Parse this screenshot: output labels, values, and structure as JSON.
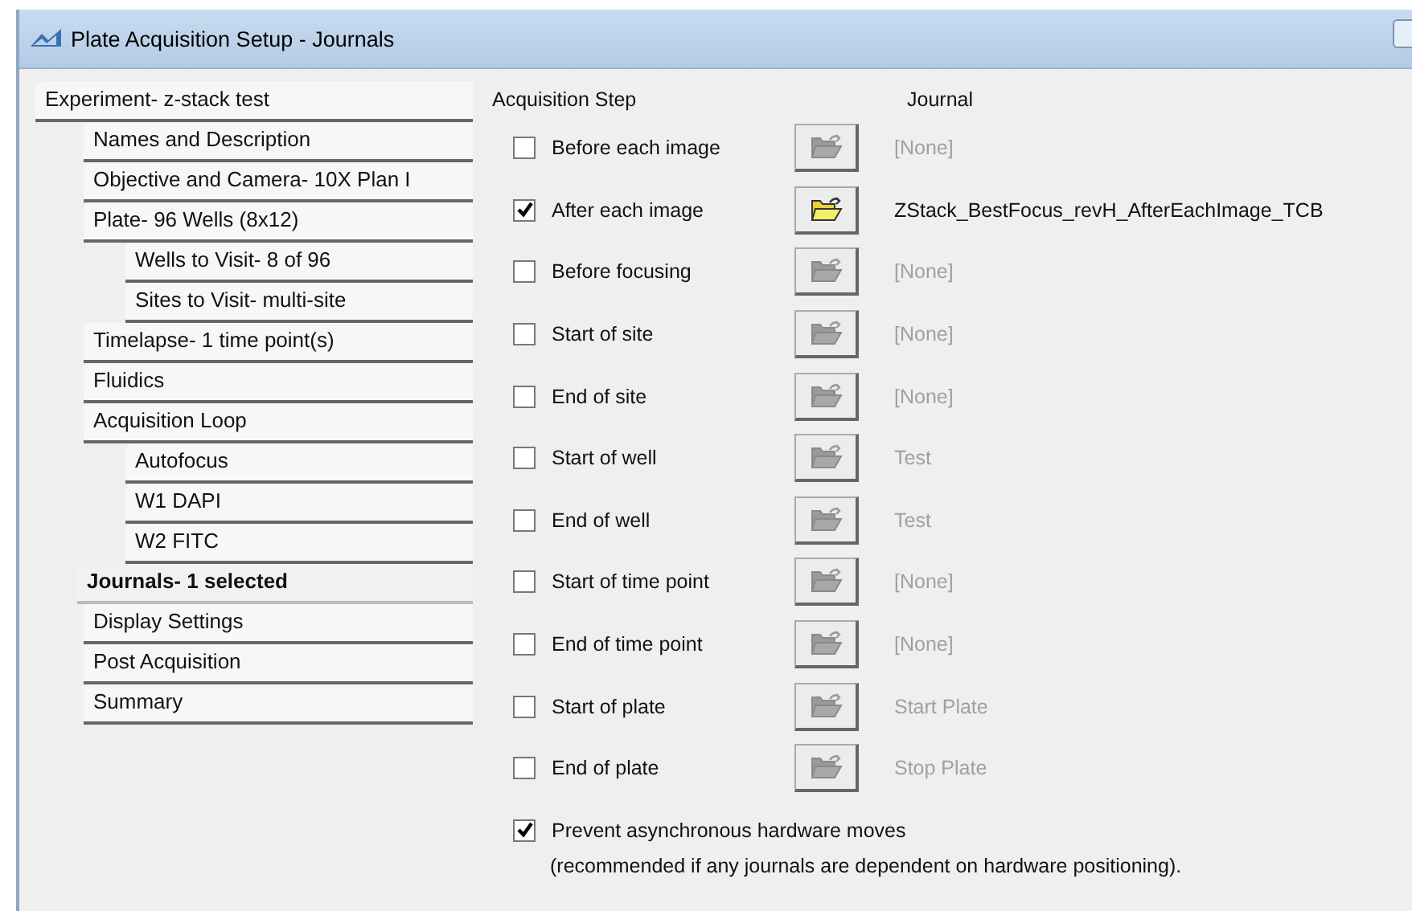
{
  "window": {
    "title": "Plate Acquisition Setup - Journals"
  },
  "tree": [
    {
      "label": "Experiment- z-stack test",
      "selected": false,
      "children": [
        {
          "label": "Names and Description",
          "selected": false
        },
        {
          "label": "Objective and Camera- 10X Plan I",
          "selected": false
        },
        {
          "label": "Plate- 96 Wells (8x12)",
          "selected": false,
          "children": [
            {
              "label": "Wells to Visit- 8 of 96",
              "selected": false
            },
            {
              "label": "Sites to Visit- multi-site",
              "selected": false
            }
          ]
        },
        {
          "label": "Timelapse- 1 time point(s)",
          "selected": false
        },
        {
          "label": "Fluidics",
          "selected": false
        },
        {
          "label": "Acquisition Loop",
          "selected": false,
          "children": [
            {
              "label": "Autofocus",
              "selected": false
            },
            {
              "label": "W1 DAPI",
              "selected": false
            },
            {
              "label": "W2 FITC",
              "selected": false
            }
          ]
        },
        {
          "label": "Journals- 1 selected",
          "selected": true
        },
        {
          "label": "Display Settings",
          "selected": false
        },
        {
          "label": "Post Acquisition",
          "selected": false
        },
        {
          "label": "Summary",
          "selected": false
        }
      ]
    }
  ],
  "headers": {
    "step": "Acquisition Step",
    "journal": "Journal"
  },
  "steps": [
    {
      "label": "Before each image",
      "checked": false,
      "journal": "[None]"
    },
    {
      "label": "After each image",
      "checked": true,
      "journal": "ZStack_BestFocus_revH_AfterEachImage_TCB"
    },
    {
      "label": "Before focusing",
      "checked": false,
      "journal": "[None]"
    },
    {
      "label": "Start of site",
      "checked": false,
      "journal": "[None]"
    },
    {
      "label": "End of site",
      "checked": false,
      "journal": "[None]"
    },
    {
      "label": "Start of well",
      "checked": false,
      "journal": "Test"
    },
    {
      "label": "End of well",
      "checked": false,
      "journal": "Test"
    },
    {
      "label": "Start of time point",
      "checked": false,
      "journal": "[None]"
    },
    {
      "label": "End of time point",
      "checked": false,
      "journal": "[None]"
    },
    {
      "label": "Start of plate",
      "checked": false,
      "journal": "Start Plate"
    },
    {
      "label": "End of plate",
      "checked": false,
      "journal": "Stop Plate"
    }
  ],
  "prevent": {
    "label": "Prevent asynchronous hardware moves",
    "checked": true,
    "note": "(recommended if any journals are dependent on hardware positioning)."
  }
}
